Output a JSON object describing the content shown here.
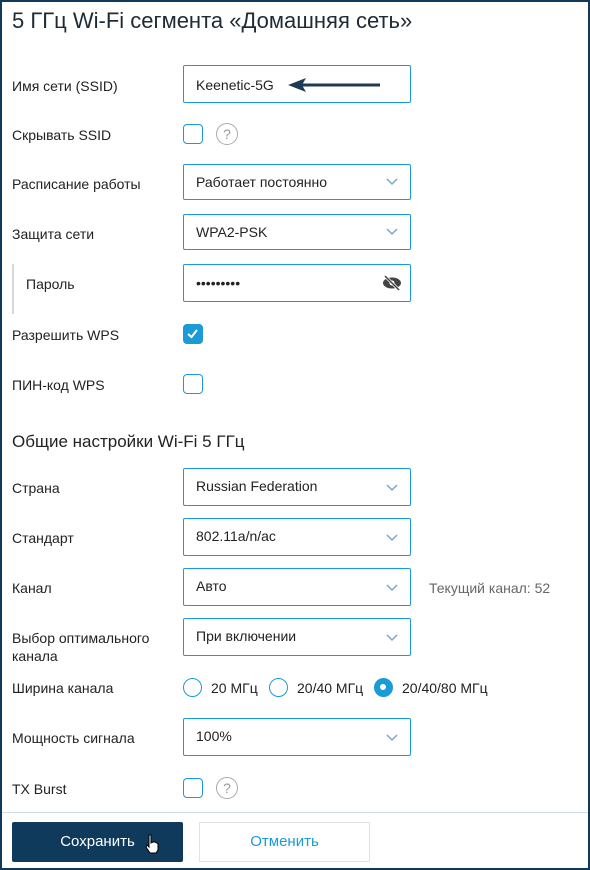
{
  "title": "5 ГГц Wi-Fi сегмента «Домашняя сеть»",
  "fields": {
    "ssid": {
      "label": "Имя сети (SSID)",
      "value": "Keenetic-5G"
    },
    "hide_ssid": {
      "label": "Скрывать SSID",
      "checked": false,
      "help": "?"
    },
    "schedule": {
      "label": "Расписание работы",
      "value": "Работает постоянно"
    },
    "security": {
      "label": "Защита сети",
      "value": "WPA2-PSK"
    },
    "password": {
      "label": "Пароль",
      "value": "•••••••••"
    },
    "allow_wps": {
      "label": "Разрешить WPS",
      "checked": true
    },
    "wps_pin": {
      "label": "ПИН-код WPS",
      "checked": false
    }
  },
  "section2": {
    "title": "Общие настройки Wi-Fi 5 ГГц",
    "country": {
      "label": "Страна",
      "value": "Russian Federation"
    },
    "standard": {
      "label": "Стандарт",
      "value": "802.11a/n/ac"
    },
    "channel": {
      "label": "Канал",
      "value": "Авто",
      "note": "Текущий канал: 52"
    },
    "optimal": {
      "label": "Выбор оптимального канала",
      "value": "При включении"
    },
    "width": {
      "label": "Ширина канала",
      "options": [
        "20 МГц",
        "20/40 МГц",
        "20/40/80 МГц"
      ],
      "selected": "20/40/80 МГц"
    },
    "power": {
      "label": "Мощность сигнала",
      "value": "100%"
    },
    "txburst": {
      "label": "TX Burst",
      "checked": false,
      "help": "?"
    }
  },
  "buttons": {
    "save": "Сохранить",
    "cancel": "Отменить"
  },
  "colors": {
    "accent": "#1a9ad6",
    "primary": "#0f3a5c"
  }
}
